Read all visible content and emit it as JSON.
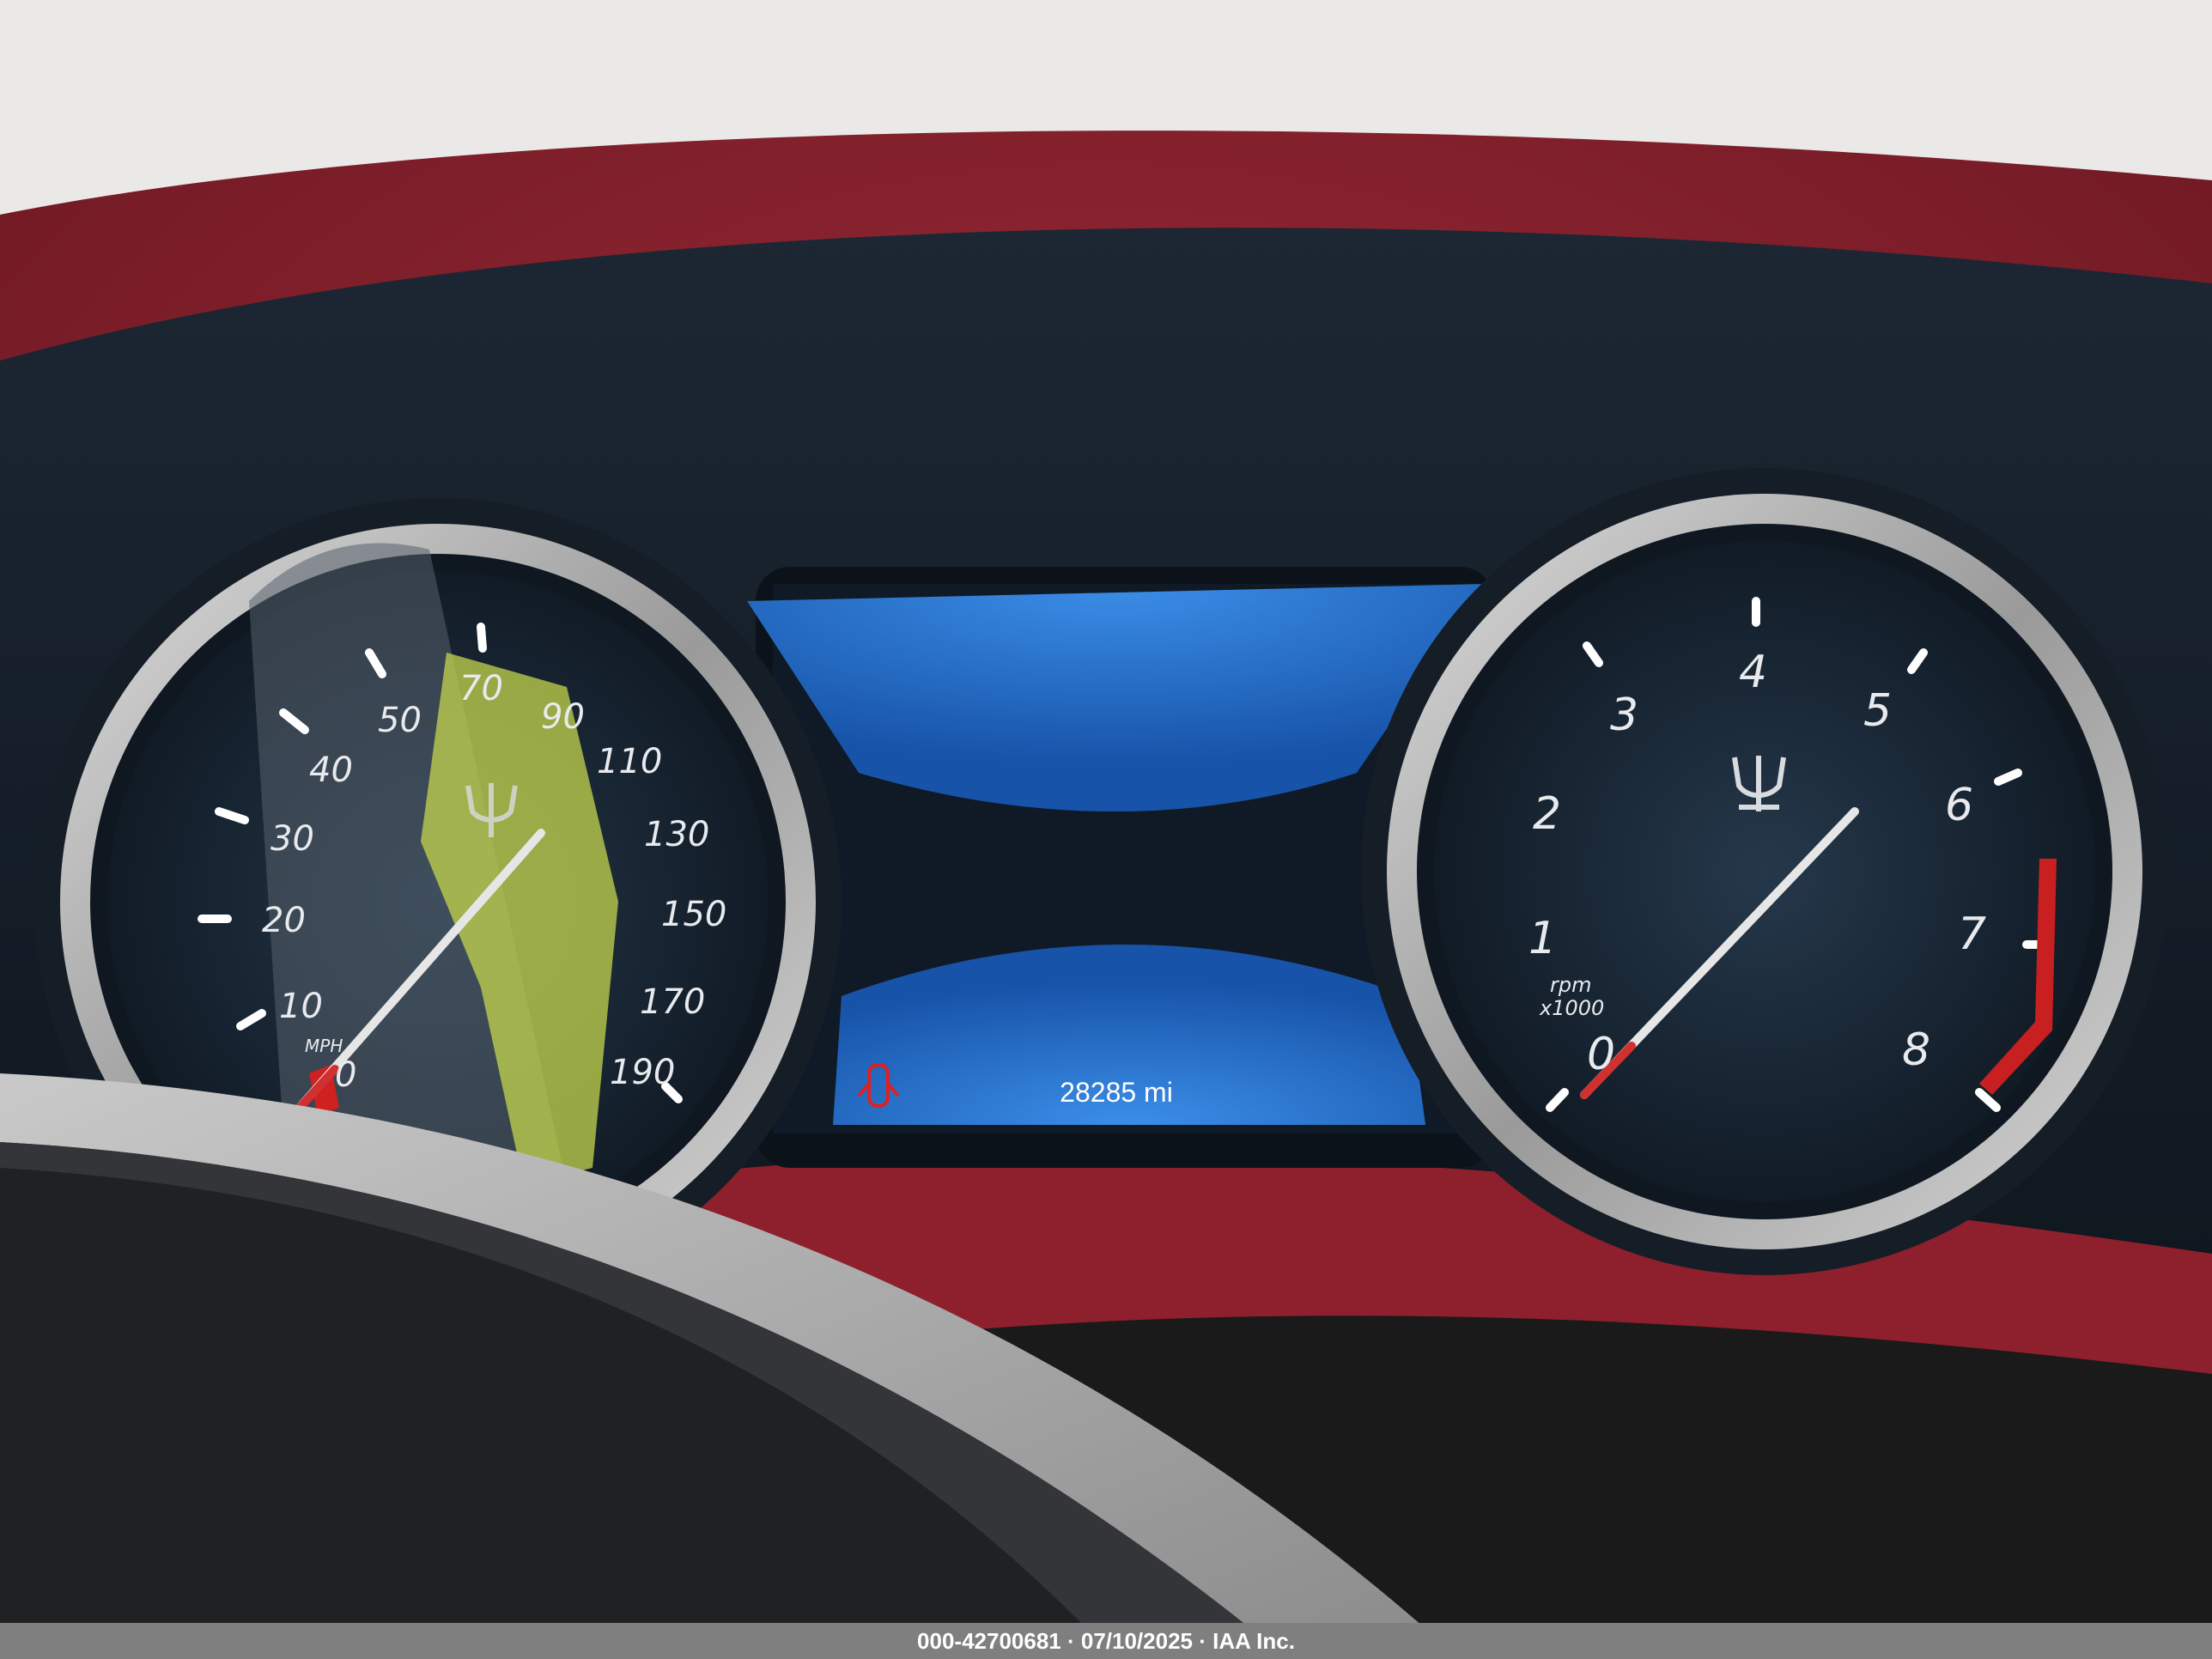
{
  "speedometer": {
    "unit": "MPH",
    "labels": [
      "0",
      "10",
      "20",
      "30",
      "40",
      "50",
      "70",
      "90",
      "110",
      "130",
      "150",
      "170",
      "190"
    ]
  },
  "tachometer": {
    "unit_line1": "rpm",
    "unit_line2": "x1000",
    "labels": [
      "0",
      "1",
      "2",
      "3",
      "4",
      "5",
      "6",
      "7",
      "8"
    ]
  },
  "display": {
    "odometer": "28285 mi",
    "door_icon": "car-door-open-icon",
    "accent_color": "#2f7fe0"
  },
  "interior_color": "#8e1f2c",
  "watermark": "000-42700681 · 07/10/2025 · IAA Inc."
}
